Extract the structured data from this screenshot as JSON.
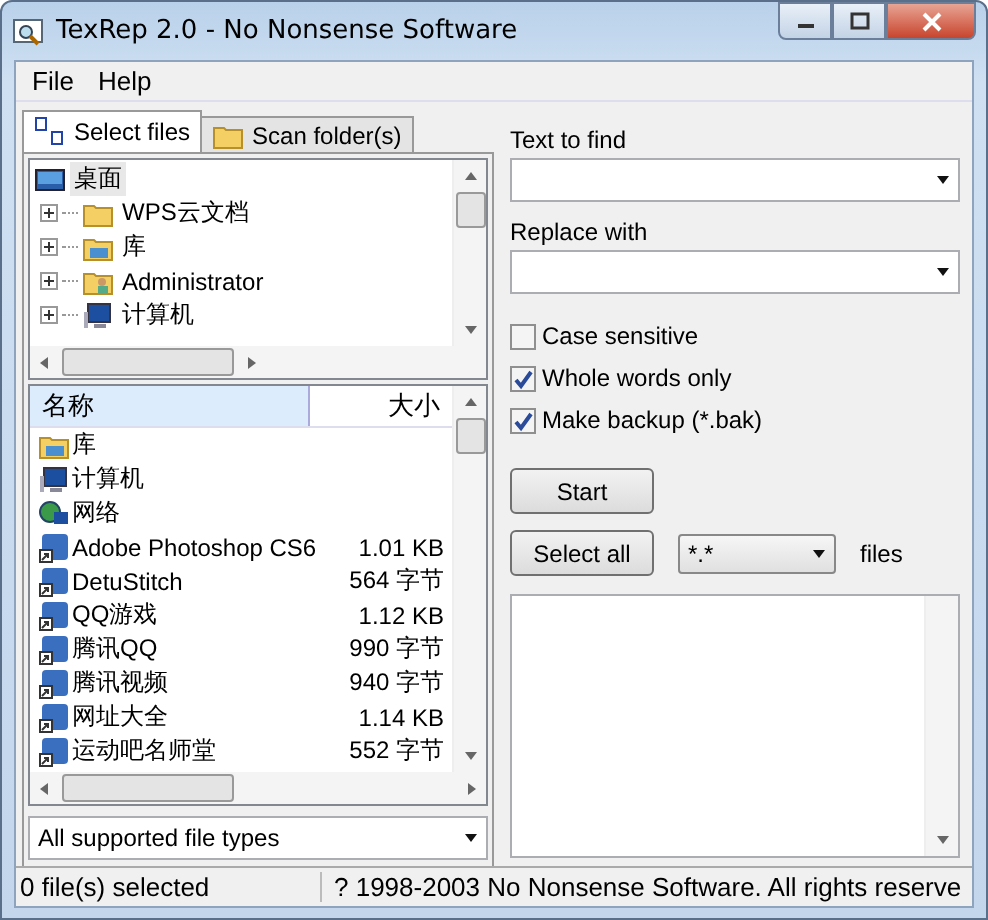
{
  "window": {
    "title": "TexRep 2.0 - No Nonsense Software"
  },
  "menu": [
    "File",
    "Help"
  ],
  "tabs": [
    {
      "label": "Select files",
      "selected": true,
      "kind": "files"
    },
    {
      "label": "Scan folder(s)",
      "selected": false,
      "kind": "folder"
    }
  ],
  "tree": [
    {
      "label": "桌面",
      "kind": "desktop",
      "selected": true,
      "children": [
        {
          "label": "WPS云文档",
          "kind": "folder",
          "expanded": false
        },
        {
          "label": "库",
          "kind": "library",
          "expanded": false
        },
        {
          "label": "Administrator",
          "kind": "user",
          "expanded": false
        },
        {
          "label": "计算机",
          "kind": "computer",
          "expanded": false
        }
      ]
    }
  ],
  "file_list": {
    "columns": [
      "名称",
      "大小"
    ],
    "rows": [
      {
        "name": "库",
        "size": "",
        "kind": "library"
      },
      {
        "name": "计算机",
        "kind": "computer"
      },
      {
        "name": "网络",
        "kind": "network"
      },
      {
        "name": "Adobe Photoshop CS6",
        "size": "1.01 KB",
        "kind": "shortcut"
      },
      {
        "name": "DetuStitch",
        "size": "564 字节",
        "kind": "shortcut"
      },
      {
        "name": "QQ游戏",
        "size": "1.12 KB",
        "kind": "shortcut"
      },
      {
        "name": "腾讯QQ",
        "size": "990 字节",
        "kind": "shortcut"
      },
      {
        "name": "腾讯视频",
        "size": "940 字节",
        "kind": "shortcut"
      },
      {
        "name": "网址大全",
        "size": "1.14 KB",
        "kind": "shortcut"
      },
      {
        "name": "运动吧名师堂",
        "size": "552 字节",
        "kind": "shortcut"
      }
    ]
  },
  "file_filter": {
    "value": "All supported file types"
  },
  "find": {
    "label": "Text to find"
  },
  "replace": {
    "label": "Replace with"
  },
  "options": [
    {
      "label": "Case sensitive",
      "checked": false
    },
    {
      "label": "Whole words only",
      "checked": true
    },
    {
      "label": "Make backup (*.bak)",
      "checked": true
    }
  ],
  "start_button": "Start",
  "select_all_button": "Select all",
  "mask": {
    "value": "*.*",
    "suffix": "files"
  },
  "status_bar": [
    "0 file(s) selected",
    "? 1998-2003 No Nonsense Software. All rights reserve"
  ]
}
